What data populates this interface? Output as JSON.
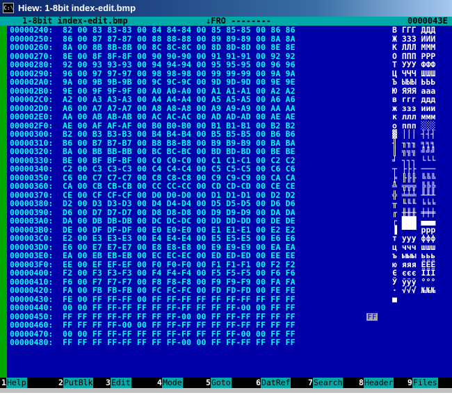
{
  "window": {
    "title": "Hiew: 1-8bit index-edit.bmp",
    "icon": "console-icon",
    "icon_text": "C:\\"
  },
  "infobar": {
    "filename": "1-8bit index-edit.bmp",
    "mode": "↓FRO --------",
    "offset": "0000043E"
  },
  "rows": [
    {
      "off": "00000240:",
      "hex": "82 00 83 83-83 00 84 84-84 00 85 85-85 00 86 86",
      "asc": "В ГГГ ДДД"
    },
    {
      "off": "00000250:",
      "hex": "86 00 87 87-87 00 88 88-88 00 89 89-89 00 8A 8A",
      "asc": "Ж ЗЗЗ ИИИ"
    },
    {
      "off": "00000260:",
      "hex": "8A 00 8B 8B-8B 00 8C 8C-8C 00 8D 8D-8D 00 8E 8E",
      "asc": "К ЛЛЛ МММ"
    },
    {
      "off": "00000270:",
      "hex": "8E 00 8F 8F-8F 00 90 90-90 00 91 91-91 00 92 92",
      "asc": "О ППП PPP"
    },
    {
      "off": "00000280:",
      "hex": "92 00 93 93-93 00 94 94-94 00 95 95-95 00 96 96",
      "asc": "Т УУУ ФФФ"
    },
    {
      "off": "00000290:",
      "hex": "96 00 97 97-97 00 98 98-98 00 99 99-99 00 9A 9A",
      "asc": "Ц ЧЧЧ ШШШ"
    },
    {
      "off": "000002A0:",
      "hex": "9A 00 9B 9B-9B 00 9C 9C-9C 00 9D 9D-9D 00 9E 9E",
      "asc": "Ъ ЫЫЫ ЬЬЬ"
    },
    {
      "off": "000002B0:",
      "hex": "9E 00 9F 9F-9F 00 A0 A0-A0 00 A1 A1-A1 00 A2 A2",
      "asc": "Ю ЯЯЯ ааа"
    },
    {
      "off": "000002C0:",
      "hex": "A2 00 A3 A3-A3 00 A4 A4-A4 00 A5 A5-A5 00 A6 A6",
      "asc": "в ггг ддд"
    },
    {
      "off": "000002D0:",
      "hex": "A6 00 A7 A7-A7 00 A8 A8-A8 00 A9 A9-A9 00 AA AA",
      "asc": "ж ззз иии"
    },
    {
      "off": "000002E0:",
      "hex": "AA 00 AB AB-AB 00 AC AC-AC 00 AD AD-AD 00 AE AE",
      "asc": "к ллл ммм"
    },
    {
      "off": "000002F0:",
      "hex": "AE 00 AF AF-AF 00 B0 B0-B0 00 B1 B1-B1 00 B2 B2",
      "asc": "о ппп ░░░"
    },
    {
      "off": "00000300:",
      "hex": "B2 00 B3 B3-B3 00 B4 B4-B4 00 B5 B5-B5 00 B6 B6",
      "asc": "▓ │││ ┤┤┤"
    },
    {
      "off": "00000310:",
      "hex": "B6 00 B7 B7-B7 00 B8 B8-B8 00 B9 B9-B9 00 BA BA",
      "asc": "╢ ╖╖╖ ╕╕╕"
    },
    {
      "off": "00000320:",
      "hex": "BA 00 BB BB-BB 00 BC BC-BC 00 BD BD-BD 00 BE BE",
      "asc": "║ ╗╗╗ ╝╝╝"
    },
    {
      "off": "00000330:",
      "hex": "BE 00 BF BF-BF 00 C0 C0-C0 00 C1 C1-C1 00 C2 C2",
      "asc": "╛ ┐┐┐ └└└"
    },
    {
      "off": "00000340:",
      "hex": "C2 00 C3 C3-C3 00 C4 C4-C4 00 C5 C5-C5 00 C6 C6",
      "asc": "┬ ├├├ ───"
    },
    {
      "off": "00000350:",
      "hex": "C6 00 C7 C7-C7 00 C8 C8-C8 00 C9 C9-C9 00 CA CA",
      "asc": "╞ ╟╟╟ ╚╚╚"
    },
    {
      "off": "00000360:",
      "hex": "CA 00 CB CB-CB 00 CC CC-CC 00 CD CD-CD 00 CE CE",
      "asc": "╩ ╦╦╦ ╠╠╠"
    },
    {
      "off": "00000370:",
      "hex": "CE 00 CF CF-CF 00 D0 D0-D0 00 D1 D1-D1 00 D2 D2",
      "asc": "╬ ╧╧╧ ╨╨╨"
    },
    {
      "off": "00000380:",
      "hex": "D2 00 D3 D3-D3 00 D4 D4-D4 00 D5 D5-D5 00 D6 D6",
      "asc": "╥ ╙╙╙ ╘╘╘"
    },
    {
      "off": "00000390:",
      "hex": "D6 00 D7 D7-D7 00 D8 D8-D8 00 D9 D9-D9 00 DA DA",
      "asc": "╓ ╫╫╫ ╪╪╪"
    },
    {
      "off": "000003A0:",
      "hex": "DA 00 DB DB-DB 00 DC DC-DC 00 DD DD-DD 00 DE DE",
      "asc": "┌ ███ ▄▄▄"
    },
    {
      "off": "000003B0:",
      "hex": "DE 00 DF DF-DF 00 E0 E0-E0 00 E1 E1-E1 00 E2 E2",
      "asc": "▐ ▀▀▀ ppp"
    },
    {
      "off": "000003C0:",
      "hex": "E2 00 E3 E3-E3 00 E4 E4-E4 00 E5 E5-E5 00 E6 E6",
      "asc": "т ууу ффф"
    },
    {
      "off": "000003D0:",
      "hex": "E6 00 E7 E7-E7 00 E8 E8-E8 00 E9 E9-E9 00 EA EA",
      "asc": "ц ччч шшш"
    },
    {
      "off": "000003E0:",
      "hex": "EA 00 EB EB-EB 00 EC EC-EC 00 ED ED-ED 00 EE EE",
      "asc": "ъ ыыы ььь"
    },
    {
      "off": "000003F0:",
      "hex": "EE 00 EF EF-EF 00 F0 F0-F0 00 F1 F1-F1 00 F2 F2",
      "asc": "ю яяя ЁЁЁ"
    },
    {
      "off": "00000400:",
      "hex": "F2 00 F3 F3-F3 00 F4 F4-F4 00 F5 F5-F5 00 F6 F6",
      "asc": "Є єєє ЇЇЇ"
    },
    {
      "off": "00000410:",
      "hex": "F6 00 F7 F7-F7 00 F8 F8-F8 00 F9 F9-F9 00 FA FA",
      "asc": "Ў ўўў °°°"
    },
    {
      "off": "00000420:",
      "hex": "FA 00 FB FB-FB 00 FC FC-FC 00 FD FD-FD 00 FE FE",
      "asc": "· √√√ №№№"
    },
    {
      "off": "00000430:",
      "hex": "FE 00 FF FF-FF 00 FF FF-FF FF FF FF-FF FF FF FF",
      "asc": "■"
    },
    {
      "off": "00000440:",
      "hex": "00 00 FF FF-FF FF FF FF-FF FF FF FF-00 00 FF FF",
      "asc": ""
    },
    {
      "off": "00000450:",
      "hex": "FF FF FF FF-FF FF FF FF-00 00 FF FF-FF FF FF FF",
      "asc": ""
    },
    {
      "off": "00000460:",
      "hex": "FF FF FF FF-00 00 FF FF-FF FF FF FF-FF FF FF FF",
      "asc": ""
    },
    {
      "off": "00000470:",
      "hex": "00 00 FF FF-FF FF FF FF-FF FF FF FF-00 00 FF FF",
      "asc": ""
    },
    {
      "off": "00000480:",
      "hex": "FF FF FF FF-FF FF FF FF-00 00 FF FF-FF FF FF FF",
      "asc": ""
    }
  ],
  "cursor": {
    "value": "FF"
  },
  "keys": [
    {
      "num": "1",
      "label": "Help"
    },
    {
      "num": "2",
      "label": "PutBlk"
    },
    {
      "num": "3",
      "label": "Edit"
    },
    {
      "num": "4",
      "label": "Mode"
    },
    {
      "num": "5",
      "label": "Goto"
    },
    {
      "num": "6",
      "label": "DatRef"
    },
    {
      "num": "7",
      "label": "Search"
    },
    {
      "num": "8",
      "label": "Header"
    },
    {
      "num": "9",
      "label": "Files"
    }
  ],
  "colors": {
    "background": "#0000a8",
    "text": "#00ffff",
    "bar": "#00a8a8",
    "accent": "#00a800"
  }
}
